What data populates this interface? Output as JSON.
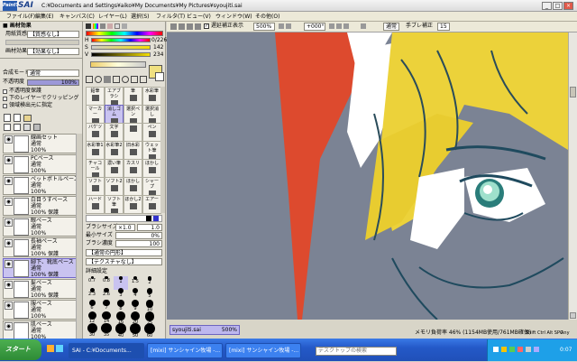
{
  "window": {
    "logo": "PaintTool",
    "app": "SAI",
    "path": "C:¥Documents and Settings¥aiko¥My Documents¥My Pictures¥syoujiti.sai"
  },
  "menu": [
    "ファイル(F)",
    "編集(E)",
    "キャンバス(C)",
    "レイヤー(L)",
    "選択(S)",
    "フィルタ(T)",
    "ビュー(V)",
    "ウィンドウ(W)",
    "その他(O)"
  ],
  "left": {
    "nav_title": "■ 画材効果",
    "paper_label": "用紙質感",
    "paper_value": "【質感なし】",
    "effect_label": "画材効果",
    "effect_value": "【効果なし】",
    "mode_label": "合成モード",
    "mode_value": "通常",
    "opacity_label": "不透明度",
    "opacity_value": "100%",
    "checks": [
      "不透明度保護",
      "下のレイヤーでクリッピング",
      "領域検出元に指定"
    ],
    "layers": [
      {
        "name": "線画セット",
        "mode": "通常",
        "opacity": "100%",
        "sel": false
      },
      {
        "name": "PCペース",
        "mode": "通常",
        "opacity": "100%",
        "sel": false
      },
      {
        "name": "ペットボトルペース",
        "mode": "通常",
        "opacity": "100%",
        "sel": false
      },
      {
        "name": "白目うすペース",
        "mode": "通常",
        "opacity": "100% 保護",
        "sel": false
      },
      {
        "name": "眼ペース",
        "mode": "通常",
        "opacity": "100%",
        "sel": false
      },
      {
        "name": "長袖ペース",
        "mode": "通常",
        "opacity": "100% 保護",
        "sel": false
      },
      {
        "name": "脚下、靴底ペース",
        "mode": "通常",
        "opacity": "100% 保護",
        "sel": true
      },
      {
        "name": "髪ペース",
        "mode": "通常",
        "opacity": "100% 保護",
        "sel": false
      },
      {
        "name": "服ペース",
        "mode": "通常",
        "opacity": "100%",
        "sel": false
      },
      {
        "name": "肌ペース",
        "mode": "通常",
        "opacity": "100%",
        "sel": false
      },
      {
        "name": "白目",
        "mode": "通常",
        "opacity": "100%",
        "sel": false
      }
    ]
  },
  "tools": {
    "rgb": {
      "h": "0/226",
      "s": "142",
      "v": "234"
    },
    "grid": [
      [
        "鉛筆",
        "エアブラシ",
        "筆",
        "水彩筆"
      ],
      [
        "マーカー",
        "消しゴム",
        "選択ペン",
        "選択消し"
      ],
      [
        "バケツ",
        "文字",
        "",
        "ペン"
      ],
      [
        "水彩筆1",
        "水彩筆2",
        "旧水彩",
        "ウェット筆"
      ],
      [
        "チャコール",
        "濃い筆",
        "カスリ",
        "ほかし"
      ],
      [
        "ソフト",
        "ソフト2",
        "ほかし",
        "シャープ"
      ],
      [
        "ハード",
        "ソフト筆",
        "ほかし2",
        "エアー"
      ]
    ],
    "brush_size_label": "ブラシサイズ",
    "brush_size_value": "×1.0",
    "brush_size_num": "1.0",
    "min_size_label": "最小サイズ",
    "min_size_value": "0%",
    "density_label": "ブラシ濃度",
    "density_value": "100",
    "shape": "【通常の円形】",
    "texture": "【テクスチャなし】",
    "detail": "詳細設定",
    "sizes": [
      "0.7",
      "0.8",
      "1",
      "1.5",
      "2",
      "2.3",
      "2.6",
      "3",
      "4",
      "5",
      "6",
      "7",
      "8",
      "9",
      "10",
      "12",
      "14",
      "16",
      "20",
      "25",
      "30",
      "35",
      "40",
      "50",
      "60"
    ]
  },
  "view": {
    "stabilizer_label": "遅延補正表示",
    "zoom": "500%",
    "angle": "+000°",
    "mode": "通常",
    "hand_label": "手ブレ補正",
    "hand_value": "15"
  },
  "status": {
    "tab": "syoujiti.sai",
    "tab_zoom": "500%",
    "memory": "メモリ負荷率 46% (1154MB使用/761MB確保)",
    "keys": "Shift Ctrl Alt SPC",
    "key_any": "Any"
  },
  "taskbar": {
    "start": "スタート",
    "tasks": [
      "SAI - C:¥Documents...",
      "[mixi] サンシャイン牧場 -...",
      "[mixi] サンシャイン牧場 -...",
      "[mixi] みんなの農園 - W..."
    ],
    "search": "デスクトップの検索",
    "time": "0:07"
  }
}
